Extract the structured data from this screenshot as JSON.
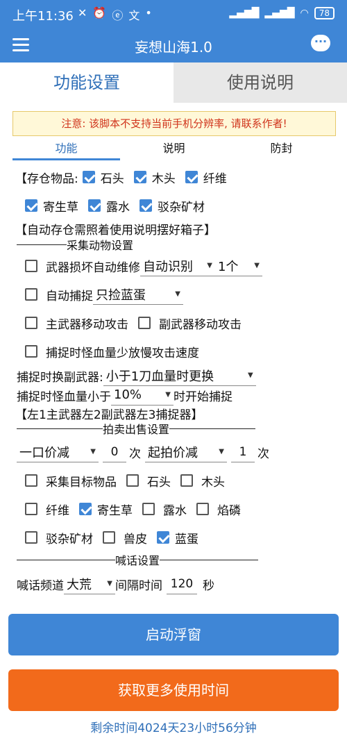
{
  "status_bar": {
    "time": "上午11:36",
    "battery": "78"
  },
  "app": {
    "title": "妄想山海1.0"
  },
  "main_tabs": {
    "settings": "功能设置",
    "instructions": "使用说明"
  },
  "notice": "注意: 该脚本不支持当前手机分辨率, 请联系作者!",
  "sub_tabs": {
    "function": "功能",
    "explanation": "说明",
    "sealing": "防封"
  },
  "storage": {
    "label": "【存仓物品:",
    "stone": "石头",
    "wood": "木头",
    "fiber": "纤维",
    "parasitic_grass": "寄生草",
    "dew": "露水",
    "mixed_ore": "驳杂矿材",
    "note": "【自动存仓需照着使用说明摆好箱子】"
  },
  "animal_section": {
    "title": "采集动物设置",
    "auto_repair": "武器损坏自动维修",
    "repair_mode": "自动识别",
    "repair_count": "1个",
    "auto_catch": "自动捕捉",
    "catch_mode": "只捡蓝蛋",
    "main_weapon_move": "主武器移动攻击",
    "sub_weapon_move": "副武器移动攻击",
    "slow_attack": "捕捉时怪血量少放慢攻击速度",
    "switch_weapon_label": "捕捉时换副武器:",
    "switch_weapon_value": "小于1刀血量时更换",
    "hp_label": "捕捉时怪血量小于",
    "hp_value": "10%",
    "hp_suffix": "时开始捕捉",
    "weapons_note": "【左1主武器左2副武器左3捕捉器】"
  },
  "auction": {
    "title": "拍卖出售设置",
    "price_mode_1": "一口价减",
    "price_value_1": "0",
    "times_1": "次",
    "price_mode_2": "起拍价减",
    "price_value_2": "1",
    "times_2": "次",
    "collect_target": "采集目标物品",
    "stone": "石头",
    "wood": "木头",
    "fiber": "纤维",
    "parasitic_grass": "寄生草",
    "dew": "露水",
    "phosphorus": "焰磷",
    "mixed_ore": "驳杂矿材",
    "hide": "兽皮",
    "blue_egg": "蓝蛋"
  },
  "shout": {
    "title": "喊话设置",
    "channel_label": "喊话频道",
    "channel_value": "大荒",
    "interval_label": "间隔时间",
    "interval_value": "120",
    "interval_unit": "秒"
  },
  "buttons": {
    "start_float": "启动浮窗",
    "get_more_time": "获取更多使用时间"
  },
  "remaining_time": "剩余时间4024天23小时56分钟",
  "colors": {
    "primary": "#3f86d6",
    "accent_orange": "#f26a1b",
    "notice_red": "#d0341c"
  }
}
